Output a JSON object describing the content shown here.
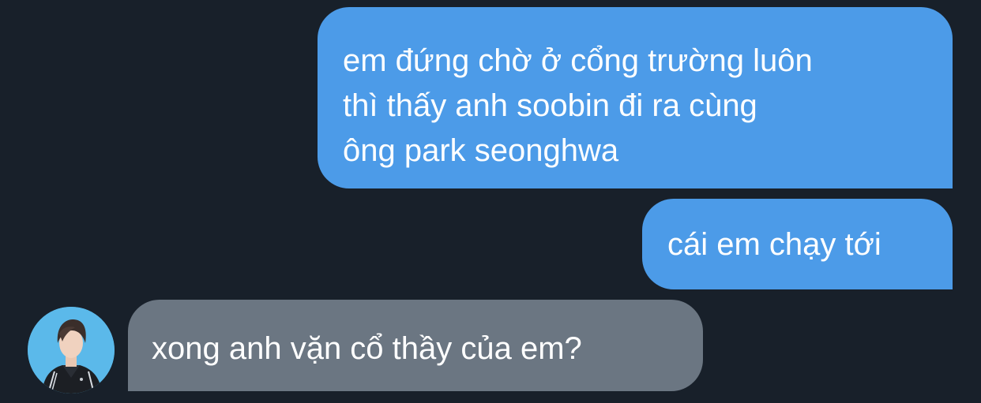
{
  "messages": [
    {
      "direction": "sent",
      "lines": [
        "em đứng chờ ở cổng trường luôn",
        "thì thấy anh soobin đi ra cùng",
        "ông park seonghwa"
      ]
    },
    {
      "direction": "sent",
      "lines": [
        "cái em chạy tới"
      ]
    },
    {
      "direction": "received",
      "lines": [
        "xong anh vặn cổ thầy của em?"
      ]
    }
  ],
  "colors": {
    "background": "#18202a",
    "sent_bubble": "#4c9be8",
    "received_bubble": "#6b7682",
    "text": "#ffffff",
    "avatar_bg": "#5bb9ea"
  },
  "avatar": {
    "icon": "person-photo-avatar"
  }
}
